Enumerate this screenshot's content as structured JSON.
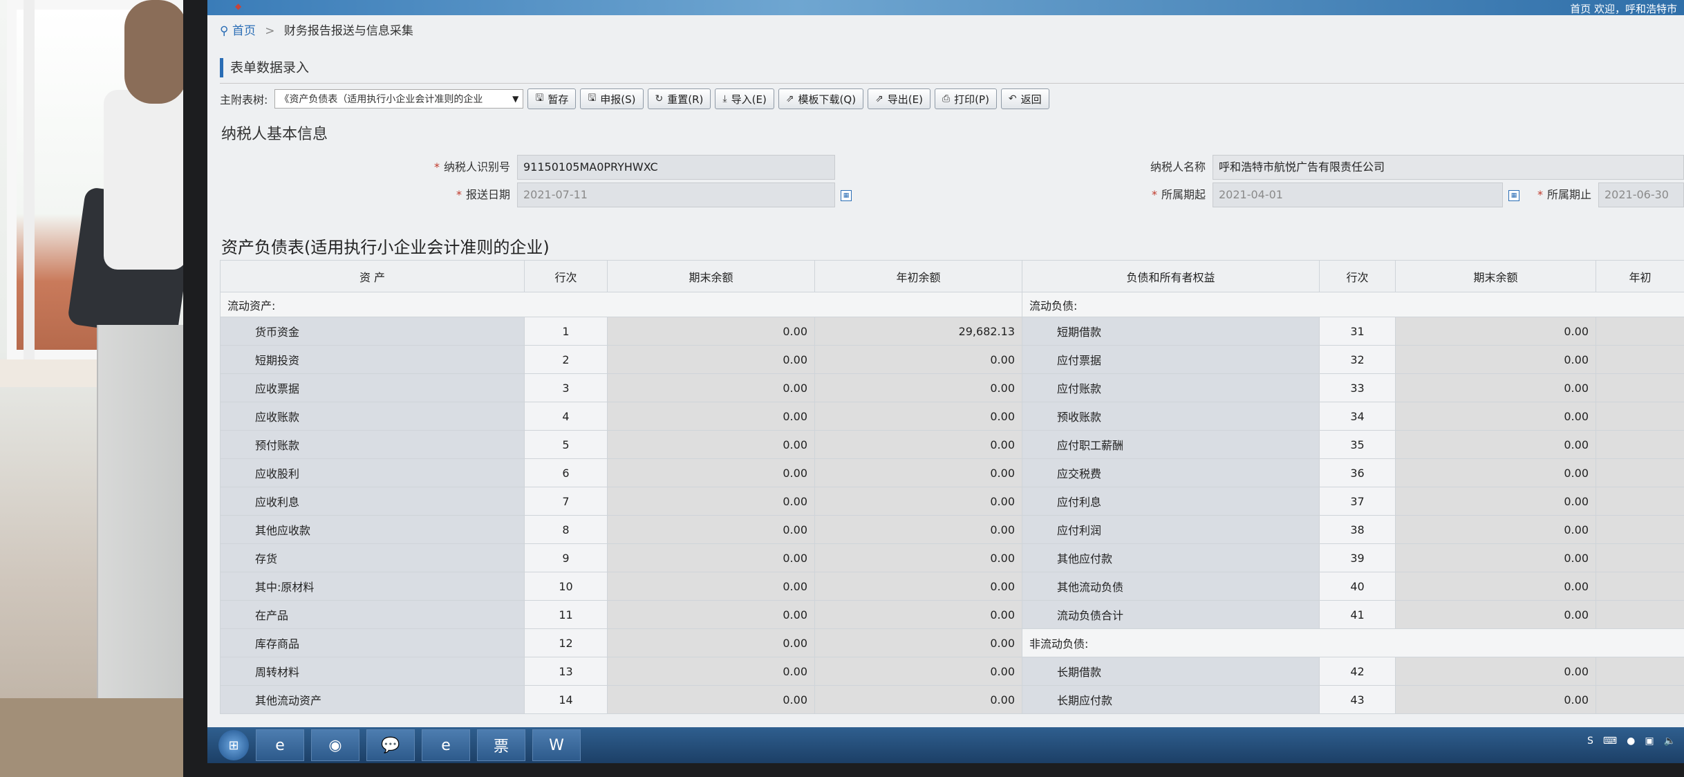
{
  "banner": {
    "welcome": "首页 欢迎，呼和浩特市"
  },
  "breadcrumb": {
    "home": "首页",
    "current": "财务报告报送与信息采集"
  },
  "section": {
    "title": "表单数据录入"
  },
  "toolbar": {
    "label": "主附表树:",
    "select_value": "《资产负债表（适用执行小企业会计准则的企业",
    "buttons": [
      "暂存",
      "申报(S)",
      "重置(R)",
      "导入(E)",
      "模板下载(Q)",
      "导出(E)",
      "打印(P)",
      "返回"
    ]
  },
  "taxpayer": {
    "title": "纳税人基本信息",
    "id_label": "纳税人识别号",
    "id_value": "91150105MA0PRYHWXC",
    "name_label": "纳税人名称",
    "name_value": "呼和浩特市航悦广告有限责任公司",
    "date_label": "报送日期",
    "date_value": "2021-07-11",
    "period_start_label": "所属期起",
    "period_start_value": "2021-04-01",
    "period_end_label": "所属期止",
    "period_end_value": "2021-06-30"
  },
  "table": {
    "title": "资产负债表(适用执行小企业会计准则的企业)",
    "headers": [
      "资 产",
      "行次",
      "期末余额",
      "年初余额",
      "负债和所有者权益",
      "行次",
      "期末余额",
      "年初"
    ],
    "left_category": "流动资产:",
    "right_category": "流动负债:",
    "right_category2": "非流动负债:",
    "rows": [
      {
        "la": "货币资金",
        "ll": "1",
        "le": "0.00",
        "lb": "29,682.13",
        "ra": "短期借款",
        "rl": "31",
        "re": "0.00"
      },
      {
        "la": "短期投资",
        "ll": "2",
        "le": "0.00",
        "lb": "0.00",
        "ra": "应付票据",
        "rl": "32",
        "re": "0.00"
      },
      {
        "la": "应收票据",
        "ll": "3",
        "le": "0.00",
        "lb": "0.00",
        "ra": "应付账款",
        "rl": "33",
        "re": "0.00"
      },
      {
        "la": "应收账款",
        "ll": "4",
        "le": "0.00",
        "lb": "0.00",
        "ra": "预收账款",
        "rl": "34",
        "re": "0.00"
      },
      {
        "la": "预付账款",
        "ll": "5",
        "le": "0.00",
        "lb": "0.00",
        "ra": "应付职工薪酬",
        "rl": "35",
        "re": "0.00"
      },
      {
        "la": "应收股利",
        "ll": "6",
        "le": "0.00",
        "lb": "0.00",
        "ra": "应交税费",
        "rl": "36",
        "re": "0.00"
      },
      {
        "la": "应收利息",
        "ll": "7",
        "le": "0.00",
        "lb": "0.00",
        "ra": "应付利息",
        "rl": "37",
        "re": "0.00"
      },
      {
        "la": "其他应收款",
        "ll": "8",
        "le": "0.00",
        "lb": "0.00",
        "ra": "应付利润",
        "rl": "38",
        "re": "0.00"
      },
      {
        "la": "存货",
        "ll": "9",
        "le": "0.00",
        "lb": "0.00",
        "ra": "其他应付款",
        "rl": "39",
        "re": "0.00"
      },
      {
        "la": "其中:原材料",
        "ll": "10",
        "le": "0.00",
        "lb": "0.00",
        "ra": "其他流动负债",
        "rl": "40",
        "re": "0.00"
      },
      {
        "la": "在产品",
        "ll": "11",
        "le": "0.00",
        "lb": "0.00",
        "ra": "流动负债合计",
        "rl": "41",
        "re": "0.00"
      },
      {
        "la": "库存商品",
        "ll": "12",
        "le": "0.00",
        "lb": "0.00",
        "ra": "",
        "rl": "",
        "re": ""
      },
      {
        "la": "周转材料",
        "ll": "13",
        "le": "0.00",
        "lb": "0.00",
        "ra": "长期借款",
        "rl": "42",
        "re": "0.00"
      },
      {
        "la": "其他流动资产",
        "ll": "14",
        "le": "0.00",
        "lb": "0.00",
        "ra": "长期应付款",
        "rl": "43",
        "re": "0.00"
      }
    ]
  },
  "taskbar": {
    "items": [
      "ie-icon",
      "chrome-icon",
      "wechat-icon",
      "ie-icon",
      "invoice-icon",
      "word-icon"
    ],
    "invoice_label": "票",
    "word_label": "W"
  }
}
